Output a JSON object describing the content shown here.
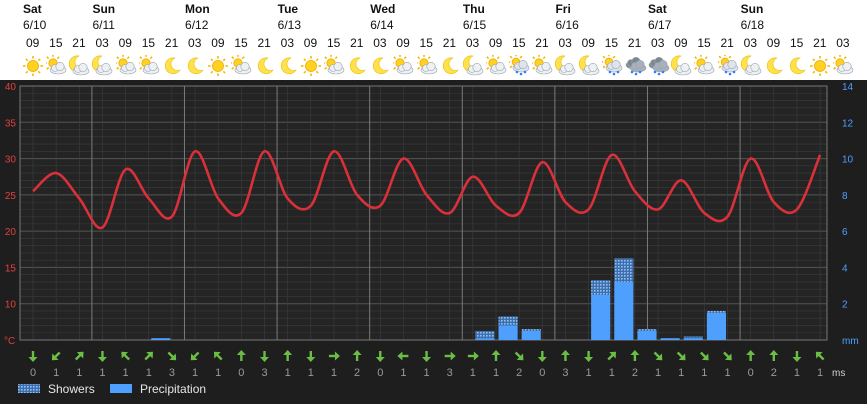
{
  "header": {
    "days": [
      {
        "day": "Sat",
        "date": "6/10"
      },
      {
        "day": "Sun",
        "date": "6/11"
      },
      {
        "day": "Mon",
        "date": "6/12"
      },
      {
        "day": "Tue",
        "date": "6/13"
      },
      {
        "day": "Wed",
        "date": "6/14"
      },
      {
        "day": "Thu",
        "date": "6/15"
      },
      {
        "day": "Fri",
        "date": "6/16"
      },
      {
        "day": "Sat",
        "date": "6/17"
      },
      {
        "day": "Sun",
        "date": "6/18"
      }
    ],
    "hours": [
      "09",
      "15",
      "21",
      "03",
      "09",
      "15",
      "21",
      "03",
      "09",
      "15",
      "21",
      "03",
      "09",
      "15",
      "21",
      "03",
      "09",
      "15",
      "21",
      "03",
      "09",
      "15",
      "21",
      "03",
      "09",
      "15",
      "21",
      "03",
      "09",
      "15",
      "21",
      "03",
      "09",
      "15",
      "21",
      "03",
      "09",
      "15",
      "21"
    ],
    "icons": [
      "sun",
      "sun-cloud",
      "moon-cloud",
      "moon-cloud",
      "sun-cloud",
      "sun-cloud",
      "moon",
      "moon",
      "sun",
      "sun-cloud",
      "moon",
      "moon",
      "sun",
      "sun-cloud",
      "moon",
      "moon",
      "sun-cloud",
      "sun-cloud",
      "moon",
      "moon-cloud",
      "sun-cloud",
      "rain",
      "sun-cloud",
      "moon-cloud",
      "moon-cloud",
      "rain",
      "rain-cloud",
      "rain-cloud",
      "moon-cloud",
      "sun-cloud",
      "rain",
      "moon-cloud",
      "moon",
      "moon",
      "sun",
      "sun-cloud",
      "moon"
    ]
  },
  "colors": {
    "temperature_line": "#d9303a",
    "precipitation": "#4f9fff",
    "showers": "#8fbfff",
    "left_axis": "#e04040",
    "right_axis": "#4f9fff",
    "wind_arrow": "#6abd45",
    "background": "#1e1e1e"
  },
  "chart_data": {
    "type": "line",
    "x": [
      "6/10 09",
      "6/10 15",
      "6/10 21",
      "6/11 03",
      "6/11 09",
      "6/11 15",
      "6/11 21",
      "6/12 03",
      "6/12 09",
      "6/12 15",
      "6/12 21",
      "6/13 03",
      "6/13 09",
      "6/13 15",
      "6/13 21",
      "6/14 03",
      "6/14 09",
      "6/14 15",
      "6/14 21",
      "6/15 03",
      "6/15 09",
      "6/15 15",
      "6/15 21",
      "6/16 03",
      "6/16 09",
      "6/16 15",
      "6/16 21",
      "6/17 03",
      "6/17 09",
      "6/17 15",
      "6/17 21",
      "6/18 03",
      "6/18 09",
      "6/18 15",
      "6/18 21"
    ],
    "series": [
      {
        "axis": "left",
        "values": [
          25.5,
          28,
          24.5,
          20.5,
          28.5,
          24.5,
          22,
          31,
          24.5,
          22.5,
          31,
          24.5,
          23.5,
          31,
          25,
          23.5,
          30,
          25,
          22.5,
          27.5,
          23.5,
          22.5,
          29.5,
          24,
          23,
          30.5,
          25.5,
          23,
          27,
          22.5,
          22,
          30,
          24,
          23,
          30.5
        ]
      },
      {
        "name": "Precipitation",
        "axis": "right",
        "values": [
          0,
          0,
          0,
          0,
          0,
          0.1,
          0,
          0,
          0,
          0,
          0,
          0,
          0,
          0,
          0,
          0,
          0,
          0,
          0,
          0.1,
          0.8,
          0.5,
          0,
          0,
          2.5,
          3.2,
          0.5,
          0.1,
          0.1,
          1.5,
          0,
          0,
          0,
          0,
          0
        ]
      },
      {
        "name": "Showers",
        "axis": "right",
        "values": [
          0,
          0,
          0,
          0,
          0,
          0,
          0,
          0,
          0,
          0,
          0,
          0,
          0,
          0,
          0,
          0,
          0,
          0,
          0,
          0.4,
          0.5,
          0.1,
          0,
          0,
          0.8,
          1.3,
          0.1,
          0,
          0.1,
          0.1,
          0,
          0,
          0,
          0,
          0
        ]
      }
    ],
    "left_axis": {
      "unit": "°C",
      "ticks": [
        40,
        35,
        30,
        25,
        20,
        15,
        10
      ],
      "ylim": [
        5,
        40
      ]
    },
    "right_axis": {
      "unit": "mm",
      "ticks": [
        14,
        12,
        10,
        8,
        6,
        4,
        2
      ],
      "ylim": [
        0,
        14
      ]
    },
    "wind": {
      "unit": "ms",
      "directions": [
        "S",
        "SW",
        "NE",
        "S",
        "NW",
        "NE",
        "SE",
        "SW",
        "NW",
        "N",
        "S",
        "N",
        "S",
        "E",
        "N",
        "S",
        "W",
        "S",
        "E",
        "E",
        "N",
        "SE",
        "S",
        "N",
        "S",
        "NE",
        "N",
        "SE",
        "SE",
        "SE",
        "SE",
        "N",
        "N",
        "S",
        "NW",
        "N",
        "N",
        "N",
        "NW",
        "W",
        "S"
      ],
      "speeds": [
        0,
        1,
        1,
        1,
        1,
        1,
        3,
        1,
        1,
        0,
        3,
        1,
        1,
        1,
        2,
        0,
        1,
        1,
        3,
        1,
        1,
        2,
        0,
        3,
        1,
        1,
        2,
        1,
        1,
        1,
        1,
        0,
        2,
        1,
        1,
        1,
        1,
        2,
        1
      ]
    },
    "legend": [
      {
        "label": "Showers",
        "key": "showers"
      },
      {
        "label": "Precipitation",
        "key": "precipitation"
      }
    ],
    "legend_position": "bottom-left",
    "grid": true
  }
}
